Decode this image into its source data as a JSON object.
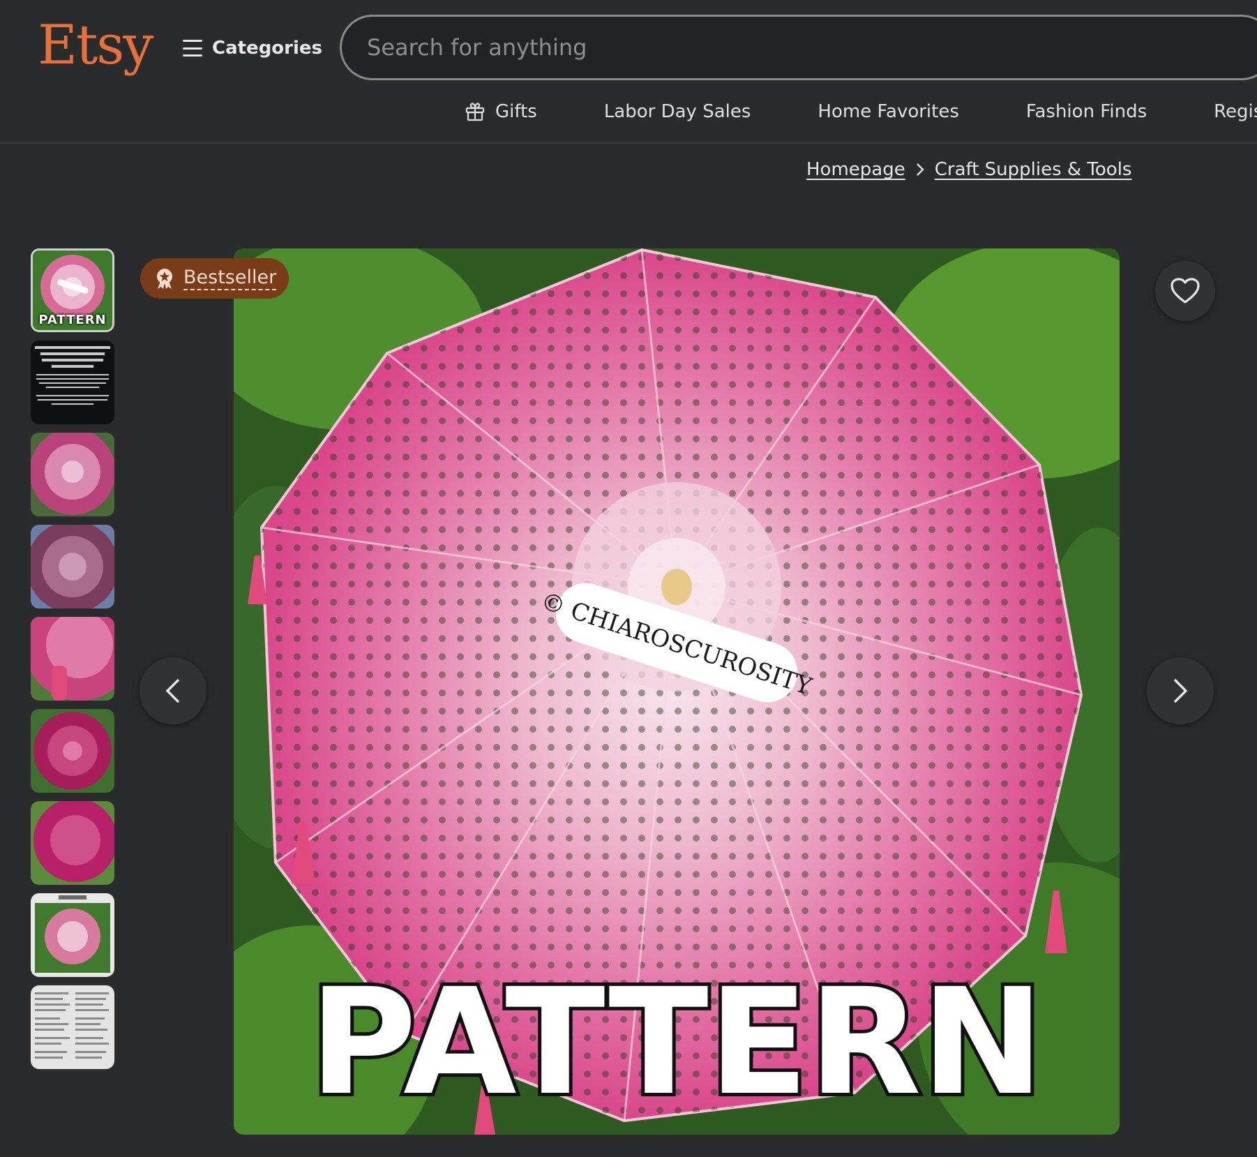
{
  "header": {
    "logo": "Etsy",
    "categories_label": "Categories",
    "search_placeholder": "Search for anything"
  },
  "nav": {
    "items": [
      {
        "label": "Gifts",
        "icon": "gift-icon"
      },
      {
        "label": "Labor Day Sales"
      },
      {
        "label": "Home Favorites"
      },
      {
        "label": "Fashion Finds"
      },
      {
        "label": "Regis"
      }
    ]
  },
  "breadcrumb": {
    "items": [
      "Homepage",
      "Craft Supplies & Tools"
    ]
  },
  "listing": {
    "badge": "Bestseller",
    "thumbnails": [
      {
        "label": "PATTERN"
      },
      {
        "label": ""
      },
      {
        "label": ""
      },
      {
        "label": ""
      },
      {
        "label": ""
      },
      {
        "label": ""
      },
      {
        "label": ""
      },
      {
        "label": ""
      },
      {
        "label": ""
      }
    ],
    "image_watermark": "© CHIAROSCUROSITY",
    "image_caption": "PATTERN"
  },
  "colors": {
    "brand": "#e8703a",
    "background": "#2a2b2d",
    "badge_bg": "#7a3b18"
  }
}
